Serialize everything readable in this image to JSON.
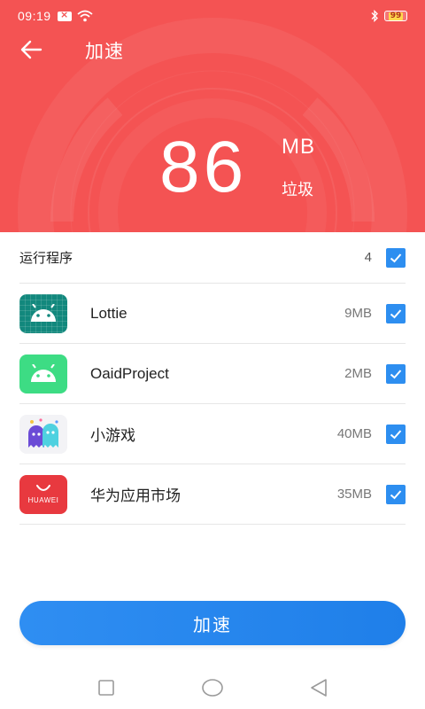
{
  "status_bar": {
    "time": "09:19",
    "battery": "99"
  },
  "toolbar": {
    "title": "加速"
  },
  "junk": {
    "value": "86",
    "unit": "MB",
    "label": "垃圾"
  },
  "summary": {
    "label": "运行程序",
    "count": "4",
    "checked": true
  },
  "apps": [
    {
      "name": "Lottie",
      "size": "9MB",
      "icon": "android-icon",
      "checked": true
    },
    {
      "name": "OaidProject",
      "size": "2MB",
      "icon": "android-icon",
      "checked": true
    },
    {
      "name": "小游戏",
      "size": "40MB",
      "icon": "ghost-game-icon",
      "checked": true
    },
    {
      "name": "华为应用市场",
      "size": "35MB",
      "icon": "huawei-appgallery-icon",
      "icon_text": "HUAWEI",
      "checked": true
    }
  ],
  "action_button": {
    "label": "加速"
  },
  "colors": {
    "header_red": "#f45353",
    "accent_blue": "#2d8ef0",
    "android_green": "#3ddc84",
    "lottie_teal": "#12887d",
    "huawei_red": "#e8393f"
  },
  "nav": {
    "icons": [
      "recent-apps-icon",
      "home-icon",
      "back-icon"
    ]
  }
}
